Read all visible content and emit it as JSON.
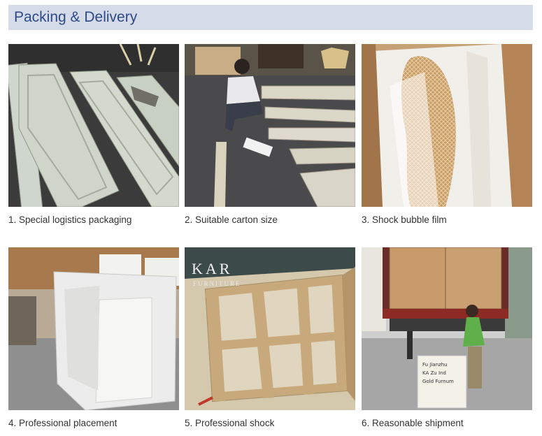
{
  "header": {
    "title": "Packing & Delivery"
  },
  "items": [
    {
      "caption": "1. Special logistics packaging"
    },
    {
      "caption": "2. Suitable carton size"
    },
    {
      "caption": "3. Shock bubble film"
    },
    {
      "caption": "4. Professional placement"
    },
    {
      "caption": "5. Professional shock"
    },
    {
      "caption": "6. Reasonable shipment"
    }
  ],
  "photos": {
    "crate_brand": "KAR",
    "crate_brand_sub": "FURNITURE",
    "shipment_sign": [
      "Fu Jianzhu",
      "KA Zu Ind",
      "Gold Furnum"
    ]
  }
}
